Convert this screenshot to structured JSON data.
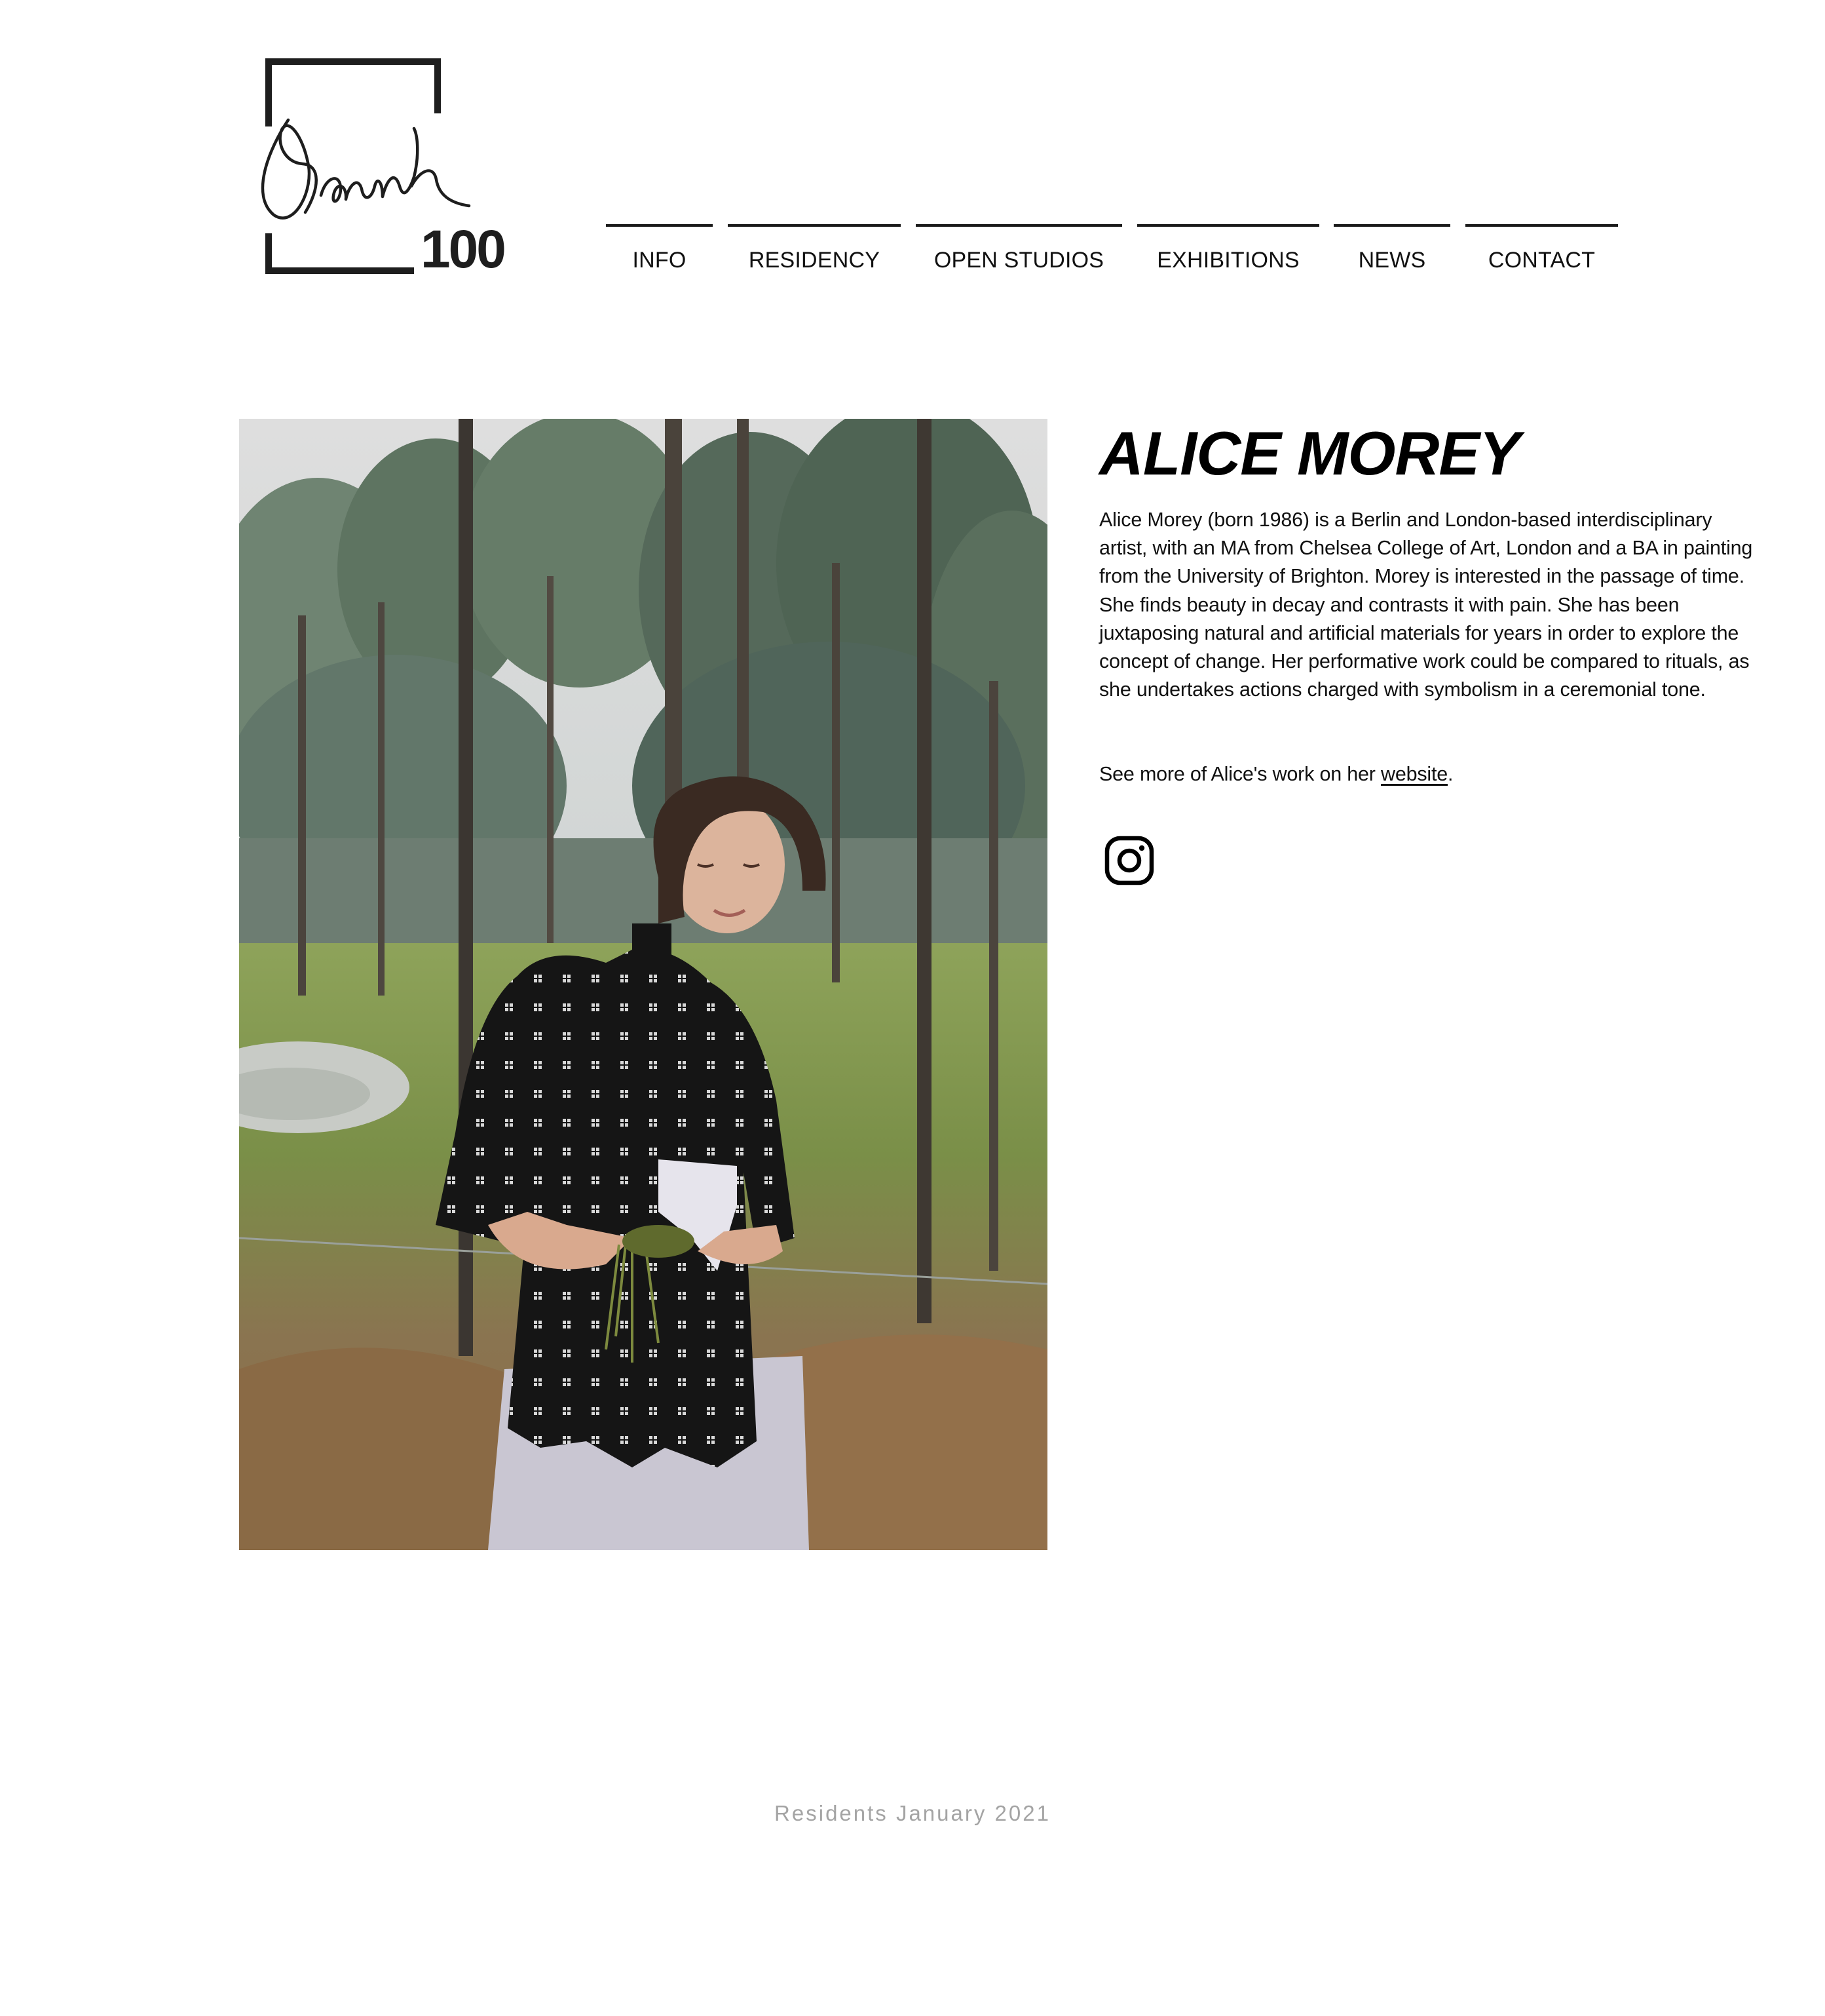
{
  "site": {
    "logo_number": "100",
    "logo_signature_text": "Blank"
  },
  "nav": {
    "items": [
      {
        "label": "INFO"
      },
      {
        "label": "RESIDENCY"
      },
      {
        "label": "OPEN STUDIOS"
      },
      {
        "label": "EXHIBITIONS"
      },
      {
        "label": "NEWS"
      },
      {
        "label": "CONTACT"
      }
    ]
  },
  "artist": {
    "name": "ALICE MOREY",
    "bio": "Alice Morey (born 1986) is a Berlin and London-based interdisciplinary artist, with an MA from Chelsea College of Art, London and a BA in painting from the University of Brighton. Morey is interested in the passage of time. She finds beauty in decay and contrasts it with pain. She has been juxtaposing natural and artificial materials for years in order to explore the concept of change. Her performative work could be compared to rituals, as she undertakes actions charged with symbolism in a ceremonial tone.",
    "see_more_prefix": "See more of Alice's work on her ",
    "see_more_link": "website",
    "see_more_suffix": ".",
    "social_icon": "instagram-icon"
  },
  "footer": {
    "caption": "Residents January 2021"
  },
  "colors": {
    "text": "#111111",
    "footer_text": "#a4a4a4",
    "background": "#ffffff",
    "logo": "#1e1e1e"
  }
}
